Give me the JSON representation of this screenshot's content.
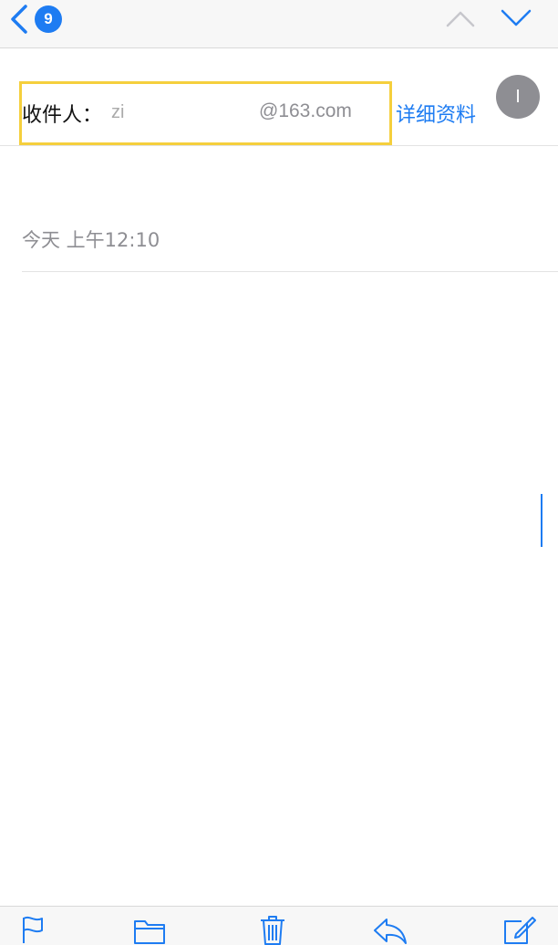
{
  "navbar": {
    "back_badge_count": "9",
    "icons": [
      "chevron-left-icon",
      "chevron-up-icon",
      "chevron-down-icon"
    ]
  },
  "message": {
    "recipient_label": "收件人：",
    "recipient_name": "zi",
    "recipient_domain": "@163.com",
    "details_link": "详细资料",
    "avatar_initial": "I",
    "timestamp": "今天 上午12:10"
  },
  "toolbar": {
    "icons": [
      "flag-icon",
      "folder-icon",
      "trash-icon",
      "reply-icon",
      "compose-icon"
    ]
  },
  "colors": {
    "accent": "#1e7cf2",
    "highlight": "#f5cf3d",
    "avatar_bg": "#8e8e93",
    "secondary_text": "#8e8e93"
  }
}
